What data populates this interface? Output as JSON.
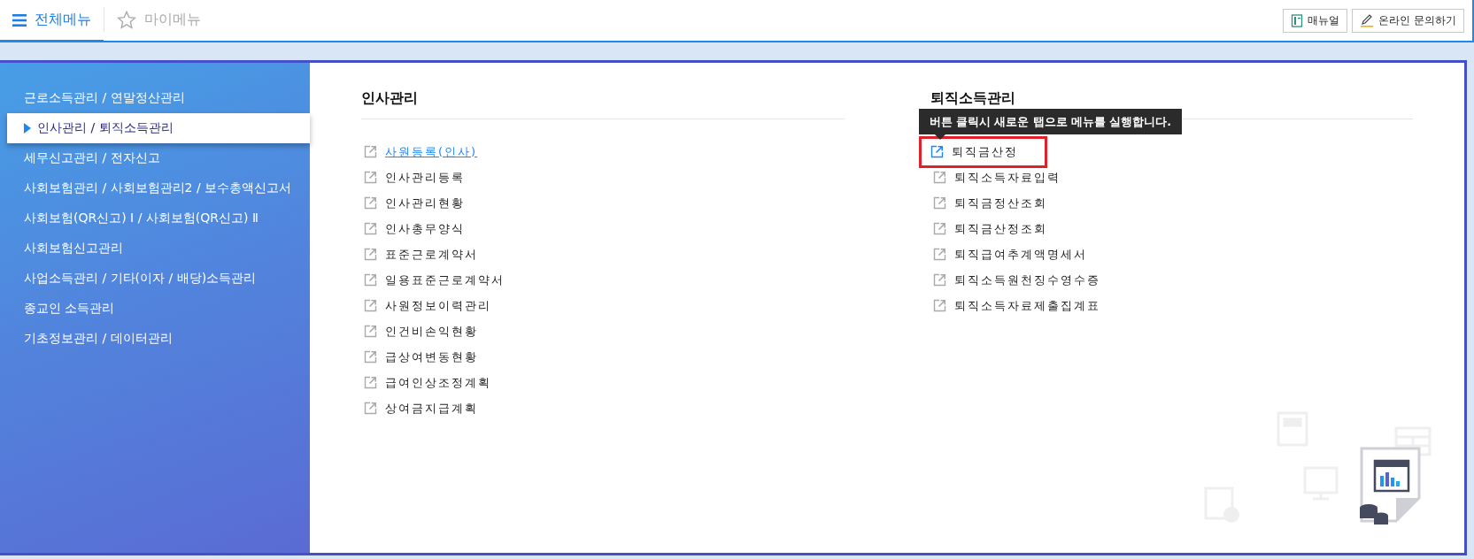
{
  "top_bar": {
    "tabs": [
      {
        "label": "전체메뉴",
        "selected": true,
        "kind": "menu"
      },
      {
        "label": "마이메뉴",
        "selected": false,
        "kind": "star"
      }
    ],
    "buttons": [
      {
        "label": "매뉴얼",
        "kind": "book"
      },
      {
        "label": "온라인 문의하기",
        "kind": "pencil"
      }
    ]
  },
  "sidebar": {
    "items": [
      {
        "label": "근로소득관리 / 연말정산관리",
        "selected": false
      },
      {
        "label": "인사관리 / 퇴직소득관리",
        "selected": true
      },
      {
        "label": "세무신고관리 / 전자신고",
        "selected": false
      },
      {
        "label": "사회보험관리 / 사회보험관리2 / 보수총액신고서",
        "selected": false
      },
      {
        "label": "사회보험(QR신고) Ⅰ / 사회보험(QR신고) Ⅱ",
        "selected": false
      },
      {
        "label": "사회보험신고관리",
        "selected": false
      },
      {
        "label": "사업소득관리 / 기타(이자 / 배당)소득관리",
        "selected": false
      },
      {
        "label": "종교인 소득관리",
        "selected": false
      },
      {
        "label": "기초정보관리 / 데이터관리",
        "selected": false
      }
    ]
  },
  "columns": [
    {
      "title": "인사관리",
      "items": [
        {
          "label": "사원등록(인사)",
          "hover": true,
          "focused": false
        },
        {
          "label": "인사관리등록",
          "hover": false,
          "focused": false
        },
        {
          "label": "인사관리현황",
          "hover": false,
          "focused": false
        },
        {
          "label": "인사총무양식",
          "hover": false,
          "focused": false
        },
        {
          "label": "표준근로계약서",
          "hover": false,
          "focused": false
        },
        {
          "label": "일용표준근로계약서",
          "hover": false,
          "focused": false
        },
        {
          "label": "사원정보이력관리",
          "hover": false,
          "focused": false
        },
        {
          "label": "인건비손익현황",
          "hover": false,
          "focused": false
        },
        {
          "label": "급상여변동현황",
          "hover": false,
          "focused": false
        },
        {
          "label": "급여인상조정계획",
          "hover": false,
          "focused": false
        },
        {
          "label": "상여금지급계획",
          "hover": false,
          "focused": false
        }
      ]
    },
    {
      "title": "퇴직소득관리",
      "items": [
        {
          "label": "퇴직금산정",
          "hover": false,
          "focused": true
        },
        {
          "label": "퇴직소득자료입력",
          "hover": false,
          "focused": false
        },
        {
          "label": "퇴직금정산조회",
          "hover": false,
          "focused": false
        },
        {
          "label": "퇴직금산정조회",
          "hover": false,
          "focused": false
        },
        {
          "label": "퇴직급여추계액명세서",
          "hover": false,
          "focused": false
        },
        {
          "label": "퇴직소득원천징수영수증",
          "hover": false,
          "focused": false
        },
        {
          "label": "퇴직소득자료제출집계표",
          "hover": false,
          "focused": false
        }
      ]
    }
  ],
  "tooltip": {
    "text": "버튼 클릭시 새로운 탭으로 메뉴를 실행합니다."
  }
}
